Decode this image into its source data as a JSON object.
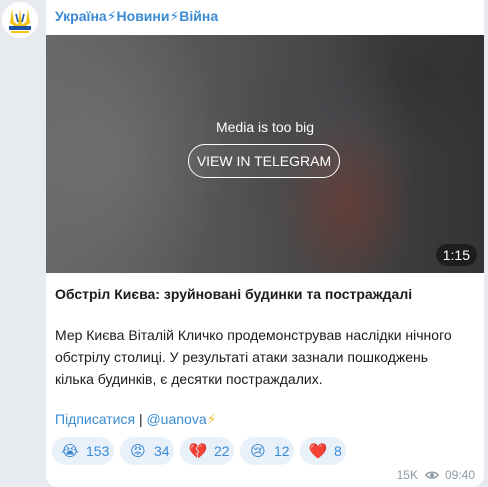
{
  "channel": {
    "name": "Україна⚡Новини⚡Війна",
    "avatar_icon": "ukraine-trident-logo-icon"
  },
  "media": {
    "notice": "Media is too big",
    "button_label": "VIEW IN TELEGRAM",
    "duration": "1:15"
  },
  "post": {
    "title": "Обстріл Києва: зруйновані будинки та постраждалі",
    "body_lines": [
      "Мер Києва Віталій Кличко продемонстрував наслідки нічного",
      "обстрілу столиці. У результаті атаки зазнали пошкоджень",
      "кілька будинків, є десятки постраждалих."
    ],
    "subscribe_label": "Підписатися",
    "separator": "|",
    "handle": "@uanova",
    "handle_icon": "⚡"
  },
  "reactions": [
    {
      "emoji": "😭",
      "icon": "crying-face-icon",
      "count": "153"
    },
    {
      "emoji": "😡",
      "icon": "angry-face-icon",
      "count": "34"
    },
    {
      "emoji": "💔",
      "icon": "broken-heart-icon",
      "count": "22"
    },
    {
      "emoji": "😢",
      "icon": "sad-face-icon",
      "count": "12"
    },
    {
      "emoji": "❤️",
      "icon": "red-heart-icon",
      "count": "8"
    }
  ],
  "meta": {
    "views": "15K",
    "views_icon": "eye-icon",
    "time": "09:40"
  },
  "colors": {
    "accent": "#3a8bd4",
    "background": "#e7ebf0",
    "reaction_bg": "#e8f1fa"
  }
}
